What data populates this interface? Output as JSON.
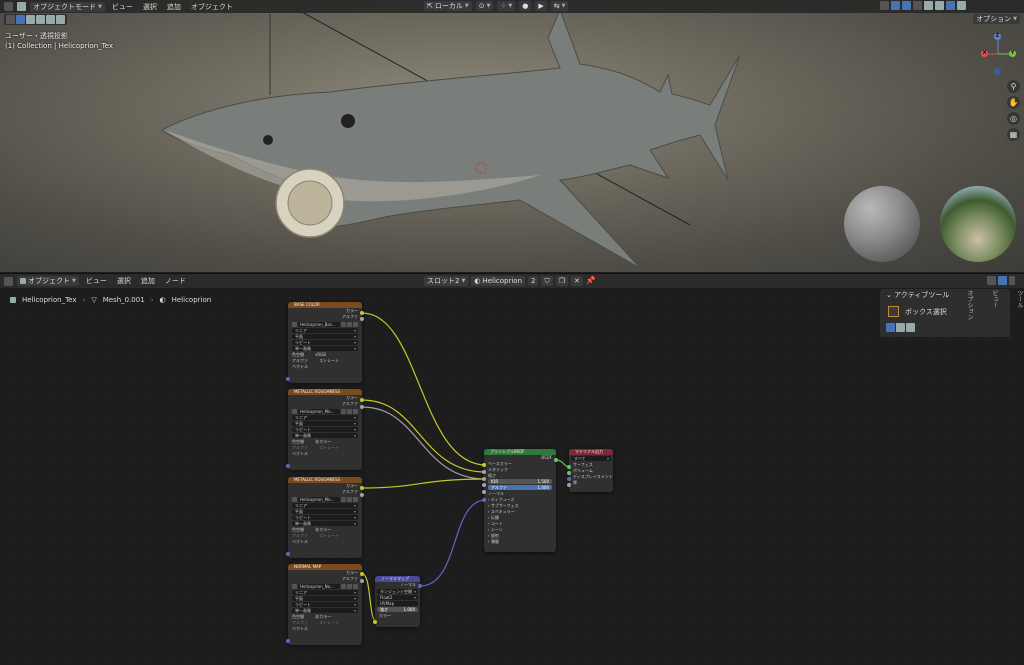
{
  "viewport": {
    "mode_label": "オブジェクトモード",
    "menus": [
      "ビュー",
      "選択",
      "追加",
      "オブジェクト"
    ],
    "transform_label": "ローカル",
    "options_label": "オプション",
    "info_line1": "ユーザー・透視投影",
    "info_line2": "(1) Collection | Helicoprion_Tex",
    "gizmo": {
      "z": "Z",
      "x": "X",
      "y": "Y"
    }
  },
  "node_editor": {
    "type_label": "オブジェクト",
    "menus": [
      "ビュー",
      "選択",
      "追加",
      "ノード"
    ],
    "slot_label": "スロット2",
    "material_name": "Helicoprion",
    "user_count": "2",
    "breadcrumb": [
      "Helicoprion_Tex",
      "Mesh_0.001",
      "Helicoprion"
    ]
  },
  "nodes": {
    "base_color": {
      "title": "BASE COLOR",
      "out_color": "カラー",
      "out_alpha": "アルファ",
      "image": "Helicoprion_Bas...",
      "rows": [
        "リニア",
        "平面",
        "リピート",
        "単一画像"
      ],
      "colorspace_label": "色空間",
      "colorspace_val": "sRGB",
      "alpha_label": "アルファ",
      "alpha_val": "ストレート",
      "in_vector": "ベクトル"
    },
    "metallic_1": {
      "title": "METALLIC ROUGHNESS",
      "out_color": "カラー",
      "out_alpha": "アルファ",
      "image": "Helicoprion_Me...",
      "rows": [
        "リニア",
        "平面",
        "リピート",
        "単一画像"
      ],
      "colorspace_label": "色空間",
      "colorspace_val": "非カラー",
      "alpha_label": "アルファ",
      "alpha_val": "ストレート",
      "in_vector": "ベクトル"
    },
    "metallic_2": {
      "title": "METALLIC ROUGHNESS",
      "out_color": "カラー",
      "out_alpha": "アルファ",
      "image": "Helicoprion_Me...",
      "rows": [
        "リニア",
        "平面",
        "リピート",
        "単一画像"
      ],
      "colorspace_label": "色空間",
      "colorspace_val": "非カラー",
      "alpha_label": "アルファ",
      "alpha_val": "ストレート",
      "in_vector": "ベクトル"
    },
    "normal": {
      "title": "NORMAL MAP",
      "out_color": "カラー",
      "out_alpha": "アルファ",
      "image": "Helicoprion_No...",
      "rows": [
        "リニア",
        "平面",
        "リピート",
        "単一画像"
      ],
      "colorspace_label": "色空間",
      "colorspace_val": "非カラー",
      "alpha_label": "アルファ",
      "alpha_val": "ストレート",
      "in_vector": "ベクトル"
    },
    "normal_map": {
      "title": "ノーマルマップ",
      "out_normal": "ノーマル",
      "space": "タンジェント空間",
      "uv_label": "Float2",
      "uv_map": "UVMap",
      "strength_label": "強さ",
      "strength_val": "1.000",
      "in_color": "カラー"
    },
    "principled": {
      "title": "プリンシプルBSDF",
      "out_bsdf": "BSDF",
      "in_base": "ベースカラー",
      "in_metal": "メタリック",
      "in_rough": "粗さ",
      "ior_label": "IOR",
      "ior_val": "1.500",
      "alpha_label": "アルファ",
      "alpha_val": "1.000",
      "in_normal": "ノーマル",
      "sections": [
        "ディフューズ",
        "サブサーフェス",
        "スペキュラー",
        "伝播",
        "コート",
        "シーン",
        "放射",
        "薄膜"
      ]
    },
    "output": {
      "title": "マテリアル出力",
      "target": "すべて",
      "in_surface": "サーフェス",
      "in_volume": "ボリューム",
      "in_disp": "ディスプレイスメント",
      "in_thick": "厚"
    }
  },
  "npanel": {
    "title": "アクティブツール",
    "tool_name": "ボックス選択",
    "tabs": [
      "ツール",
      "ビュー",
      "オプション"
    ]
  },
  "colors": {
    "wire_color": "#c7c729",
    "wire_float": "#a1a1a1",
    "wire_vector": "#6363c7",
    "wire_shader": "#63c763",
    "accent": "#4772b3"
  }
}
